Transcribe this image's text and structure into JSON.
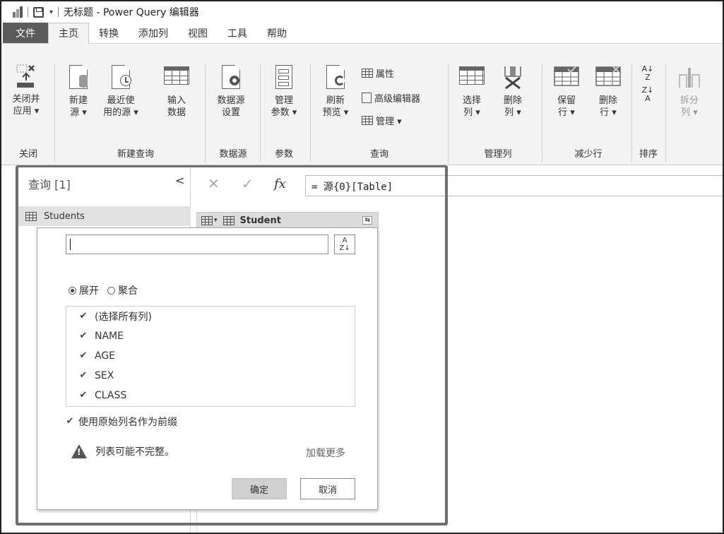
{
  "titlebar": {
    "title": "无标题 - Power Query 编辑器"
  },
  "tabs": [
    {
      "label": "文件"
    },
    {
      "label": "主页"
    },
    {
      "label": "转换"
    },
    {
      "label": "添加列"
    },
    {
      "label": "视图"
    },
    {
      "label": "工具"
    },
    {
      "label": "帮助"
    }
  ],
  "ribbon": {
    "close_apply": [
      "关闭并",
      "应用 ▾"
    ],
    "new_source": [
      "新建",
      "源 ▾"
    ],
    "recent_sources": [
      "最近使",
      "用的源 ▾"
    ],
    "enter_data": [
      "输入",
      "数据"
    ],
    "datasource_settings": [
      "数据源",
      "设置"
    ],
    "manage_params": [
      "管理",
      "参数 ▾"
    ],
    "refresh_preview": [
      "刷新",
      "预览 ▾"
    ],
    "properties": "属性",
    "advanced_editor": "高级编辑器",
    "manage": "管理 ▾",
    "choose_cols": [
      "选择",
      "列 ▾"
    ],
    "remove_cols": [
      "删除",
      "列 ▾"
    ],
    "keep_rows": [
      "保留",
      "行 ▾"
    ],
    "remove_rows": [
      "删除",
      "行 ▾"
    ],
    "split_col": [
      "拆分",
      "列 ▾"
    ],
    "groups": {
      "close": "关闭",
      "new_query": "新建查询",
      "datasource": "数据源",
      "params": "参数",
      "query": "查询",
      "manage_cols": "管理列",
      "reduce_rows": "减少行",
      "sort": "排序"
    }
  },
  "query_panel": {
    "title": "查询 [1]",
    "collapse": "<",
    "items": [
      {
        "label": "Students"
      }
    ]
  },
  "formula": {
    "text": "= 源{0}[Table]",
    "fx": "fx"
  },
  "grid": {
    "column_name": "Student"
  },
  "expand_popup": {
    "search_value": "",
    "mode_expand": "展开",
    "mode_aggregate": "聚合",
    "columns": [
      {
        "label": "(选择所有列)",
        "checked": true
      },
      {
        "label": "NAME",
        "checked": true
      },
      {
        "label": "AGE",
        "checked": true
      },
      {
        "label": "SEX",
        "checked": true
      },
      {
        "label": "CLASS",
        "checked": true
      }
    ],
    "prefix_label": "使用原始列名作为前缀",
    "warning": "列表可能不完整。",
    "load_more": "加载更多",
    "ok": "确定",
    "cancel": "取消"
  }
}
